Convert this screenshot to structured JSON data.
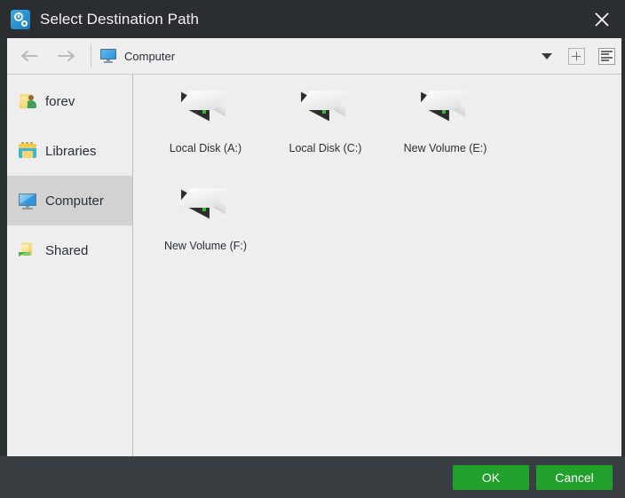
{
  "window": {
    "title": "Select Destination Path",
    "title_icon": "app-gear-icon",
    "close_icon": "close-icon"
  },
  "toolbar": {
    "back_icon": "arrow-left-icon",
    "forward_icon": "arrow-right-icon",
    "path_icon": "computer-monitor-icon",
    "path_value": "Computer",
    "dropdown_icon": "chevron-down-icon",
    "new_folder_icon": "plus-box-icon",
    "view_list_icon": "list-view-icon"
  },
  "sidebar": {
    "items": [
      {
        "label": "forev",
        "icon": "user-folder-icon",
        "selected": false
      },
      {
        "label": "Libraries",
        "icon": "libraries-icon",
        "selected": false
      },
      {
        "label": "Computer",
        "icon": "computer-monitor-icon",
        "selected": true
      },
      {
        "label": "Shared",
        "icon": "shared-folder-icon",
        "selected": false
      }
    ]
  },
  "content": {
    "drives": [
      {
        "label": "Local Disk (A:)",
        "icon": "hard-drive-icon"
      },
      {
        "label": "Local Disk (C:)",
        "icon": "hard-drive-icon"
      },
      {
        "label": "New Volume (E:)",
        "icon": "hard-drive-icon"
      },
      {
        "label": "New Volume (F:)",
        "icon": "hard-drive-icon"
      }
    ]
  },
  "footer": {
    "ok_label": "OK",
    "cancel_label": "Cancel",
    "button_color": "#22a02c",
    "background_color": "#383e41"
  }
}
